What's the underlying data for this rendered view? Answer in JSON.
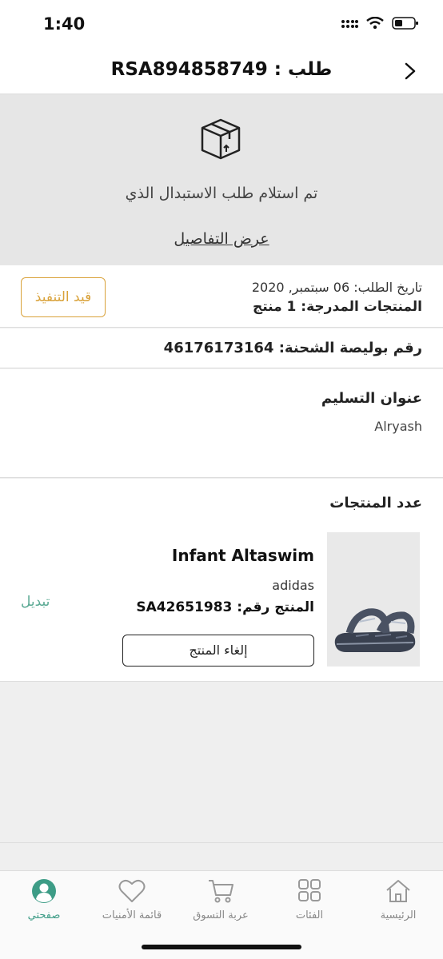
{
  "status_bar": {
    "time": "1:40",
    "icons": [
      "signal-icon",
      "wifi-icon",
      "battery-icon"
    ]
  },
  "header": {
    "title": "طلب : RSA894858749",
    "back_icon": "chevron-right-icon"
  },
  "banner": {
    "icon": "package-box-icon",
    "message": "تم استلام طلب الاستبدال الذي",
    "details_link": "عرض التفاصيل"
  },
  "order": {
    "date_line": "تاريخ الطلب: 06 سبتمبر, 2020",
    "count_line": "المنتجات المدرجة:  1 منتج",
    "status_badge": "قيد التنفيذ",
    "status_color": "#d9a23a"
  },
  "shipment": {
    "line": "رقم بوليصة الشحنة: 46176173164"
  },
  "address": {
    "title": "عنوان التسليم",
    "value": "Alryash"
  },
  "products": {
    "title": "عدد المنتجات",
    "items": [
      {
        "name": "Infant Altaswim",
        "brand": "adidas",
        "sku_line": "المنتج رقم: SA42651983",
        "action": "تبديل",
        "cancel_label": "إلغاء المنتج",
        "image": "sandal-product-image"
      }
    ]
  },
  "tab_bar": {
    "tabs": [
      {
        "label": "الرئيسية",
        "icon": "home-icon",
        "active": false
      },
      {
        "label": "الفئات",
        "icon": "grid-icon",
        "active": false
      },
      {
        "label": "عربة التسوق",
        "icon": "cart-icon",
        "active": false
      },
      {
        "label": "قائمة الأمنيات",
        "icon": "heart-icon",
        "active": false
      },
      {
        "label": "صفحتي",
        "icon": "profile-icon",
        "active": true
      }
    ],
    "accent_color": "#3d9c86"
  }
}
